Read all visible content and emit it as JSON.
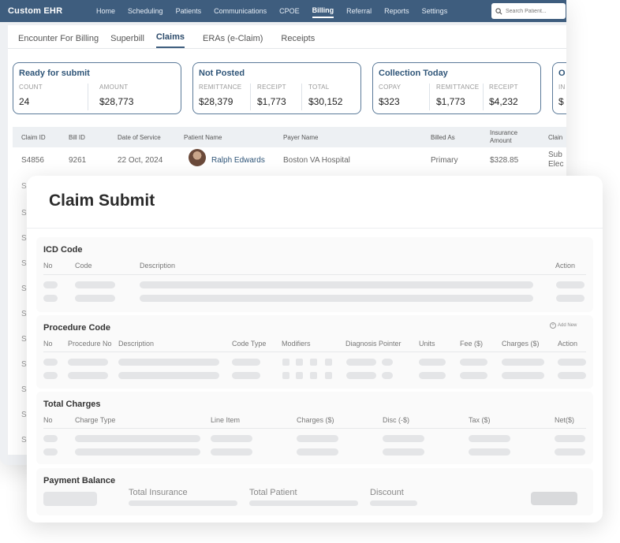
{
  "app": {
    "logo": "Custom EHR",
    "nav": [
      "Home",
      "Scheduling",
      "Patients",
      "Communications",
      "CPOE",
      "Billing",
      "Referral",
      "Reports",
      "Settings"
    ],
    "nav_active": "Billing",
    "search_placeholder": "Search Patient..."
  },
  "subtabs": [
    "Encounter For Billing",
    "Superbill",
    "Claims",
    "ERAs (e-Claim)",
    "Receipts"
  ],
  "subtab_active": "Claims",
  "cards": {
    "ready": {
      "title": "Ready for submit",
      "count_label": "COUNT",
      "count": "24",
      "amount_label": "AMOUNT",
      "amount": "$28,773"
    },
    "not_posted": {
      "title": "Not Posted",
      "remittance_label": "REMITTANCE",
      "remittance": "$28,379",
      "receipt_label": "RECEIPT",
      "receipt": "$1,773",
      "total_label": "TOTAL",
      "total": "$30,152"
    },
    "collection": {
      "title": "Collection Today",
      "copay_label": "COPAY",
      "copay": "$323",
      "remittance_label": "REMITTANCE",
      "remittance": "$1,773",
      "receipt_label": "RECEIPT",
      "receipt": "$4,232"
    },
    "partial": {
      "title": "O",
      "label": "IN",
      "value": "$"
    }
  },
  "table": {
    "headers": [
      "Claim ID",
      "Bill ID",
      "Date of Service",
      "Patient Name",
      "Payer Name",
      "Billed As",
      "Insurance Amount",
      "Clain"
    ],
    "row": {
      "claim_id": "S4856",
      "bill_id": "9261",
      "date": "22 Oct, 2024",
      "patient": "Ralph Edwards",
      "payer": "Boston VA Hospital",
      "billed_as": "Primary",
      "amount": "$328.85",
      "status_line1": "Sub",
      "status_line2": "Elec"
    },
    "ghost_rows": [
      "S",
      "S",
      "S",
      "S",
      "S",
      "S",
      "S",
      "S",
      "S",
      "S",
      "S"
    ]
  },
  "modal": {
    "title": "Claim Submit",
    "icd": {
      "title": "ICD Code",
      "headers": [
        "No",
        "Code",
        "Description",
        "Action"
      ]
    },
    "procedure": {
      "title": "Procedure Code",
      "add_new": "Add New",
      "headers": [
        "No",
        "Procedure No",
        "Description",
        "Code Type",
        "Modifiers",
        "Diagnosis Pointer",
        "Units",
        "Fee ($)",
        "Charges ($)",
        "Action"
      ]
    },
    "totals": {
      "title": "Total Charges",
      "headers": [
        "No",
        "Charge Type",
        "Line Item",
        "Charges ($)",
        "Disc (-$)",
        "Tax ($)",
        "Net($)"
      ]
    },
    "payment": {
      "title": "Payment Balance",
      "total_insurance": "Total Insurance",
      "total_patient": "Total Patient",
      "discount": "Discount"
    }
  }
}
